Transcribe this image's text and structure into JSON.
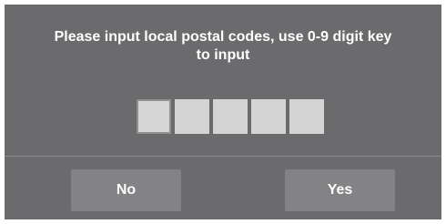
{
  "dialog": {
    "message_line1": "Please input local postal codes, use 0-9 digit key",
    "message_line2": "to input",
    "digits": [
      "",
      "",
      "",
      "",
      ""
    ],
    "no_label": "No",
    "yes_label": "Yes"
  }
}
